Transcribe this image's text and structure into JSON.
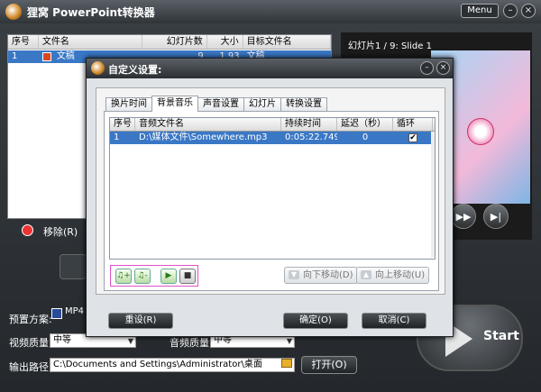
{
  "app": {
    "title": "狸窝 PowerPoint转换器",
    "menu_label": "Menu",
    "min_label": "–",
    "close_label": "×"
  },
  "file_table": {
    "columns": [
      "序号",
      "文件名",
      "幻灯片数",
      "大小",
      "目标文件名"
    ],
    "rows": [
      {
        "index": "1",
        "name": "文稿",
        "slides": "9",
        "size": "1.93",
        "target": "文稿"
      }
    ]
  },
  "left_toolbar": {
    "remove_label": "移除(R)"
  },
  "preview": {
    "label": "幻灯片1 / 9: Slide 1"
  },
  "bottom": {
    "preset_label": "预置方案:",
    "preset_value": "MP4",
    "video_quality_label": "视频质量:",
    "video_quality_value": "中等",
    "audio_quality_label": "音频质量:",
    "audio_quality_value": "中等",
    "output_label": "输出路径:",
    "output_path": "C:\\Documents and Settings\\Administrator\\桌面",
    "open_label": "打开(O)",
    "start_label": "Start"
  },
  "dialog": {
    "title": "自定义设置:",
    "tabs": [
      "换片时间",
      "背景音乐",
      "声音设置",
      "幻灯片",
      "转换设置"
    ],
    "active_tab": 1,
    "music_table": {
      "columns": [
        "序号",
        "音频文件名",
        "持续时间",
        "延迟（秒）",
        "循环"
      ],
      "rows": [
        {
          "index": "1",
          "file": "D:\\媒体文件\\Somewhere.mp3",
          "duration": "0:05:22.749",
          "delay": "0",
          "loop": true
        }
      ]
    },
    "move_down_label": "向下移动(D)",
    "move_up_label": "向上移动(U)",
    "reset_label": "重设(R)",
    "ok_label": "确定(O)",
    "cancel_label": "取消(C)"
  },
  "colors": {
    "accent_blue": "#3a78c6",
    "highlight_magenta": "#e052c9"
  }
}
